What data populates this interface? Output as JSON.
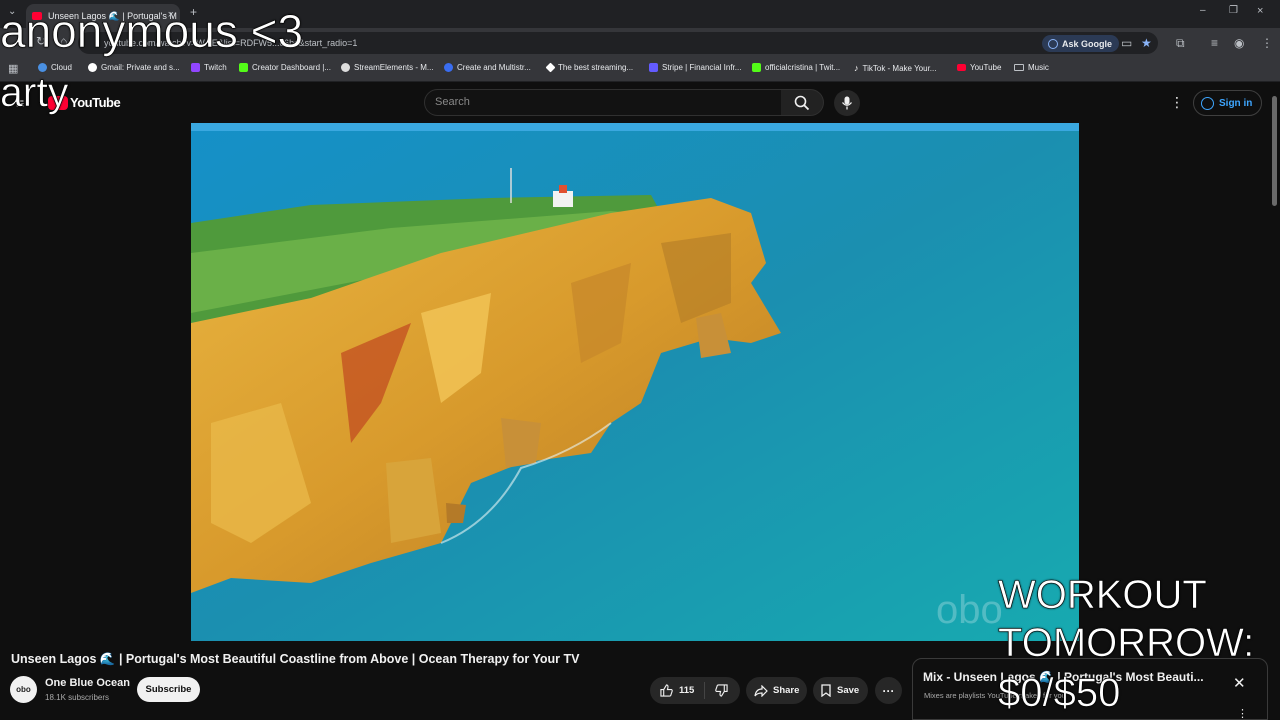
{
  "browser": {
    "tab_title": "Unseen Lagos 🌊 | Portugal's M",
    "url": "youtube.com/watch?v=W...E&list=RDFW5...c6bs&start_radio=1",
    "ask_google": "Ask Google",
    "bookmarks": [
      {
        "label": "Cloud",
        "color": "#4a90e2"
      },
      {
        "label": "Gmail: Private and s...",
        "color": "#ffffff"
      },
      {
        "label": "Twitch",
        "color": "#9146ff"
      },
      {
        "label": "Creator Dashboard |...",
        "color": "#53fc18"
      },
      {
        "label": "StreamElements - M...",
        "color": "#dddddd"
      },
      {
        "label": "Create and Multistr...",
        "color": "#3a6df0"
      },
      {
        "label": "The best streaming...",
        "color": "#ffffff"
      },
      {
        "label": "Stripe | Financial Infr...",
        "color": "#635bff"
      },
      {
        "label": "officialcristina | Twit...",
        "color": "#53fc18"
      },
      {
        "label": "TikTok - Make Your...",
        "color": "#111111"
      },
      {
        "label": "YouTube",
        "color": "#ff0033"
      },
      {
        "label": "Music",
        "color": "#bdc1c6"
      }
    ]
  },
  "youtube": {
    "logo_text": "YouTube",
    "search_placeholder": "Search",
    "signin_label": "Sign in"
  },
  "video": {
    "title": "Unseen Lagos 🌊 | Portugal's Most Beautiful Coastline from Above | Ocean Therapy for Your TV",
    "watermark": "obo"
  },
  "channel": {
    "avatar_text": "obo",
    "name": "One Blue Ocean",
    "subscribers": "18.1K subscribers",
    "subscribe_label": "Subscribe"
  },
  "actions": {
    "likes": "115",
    "share_label": "Share",
    "save_label": "Save",
    "more_label": "···"
  },
  "mix": {
    "title": "Mix - Unseen Lagos 🌊 | Portugal's Most Beauti...",
    "subtitle": "Mixes are playlists YouTube makes for you"
  },
  "overlays": {
    "line1": "anonymous <3",
    "line2": "arty",
    "goal1": "WORKOUT",
    "goal2": "TOMORROW:",
    "goal3": "$0/$50"
  }
}
